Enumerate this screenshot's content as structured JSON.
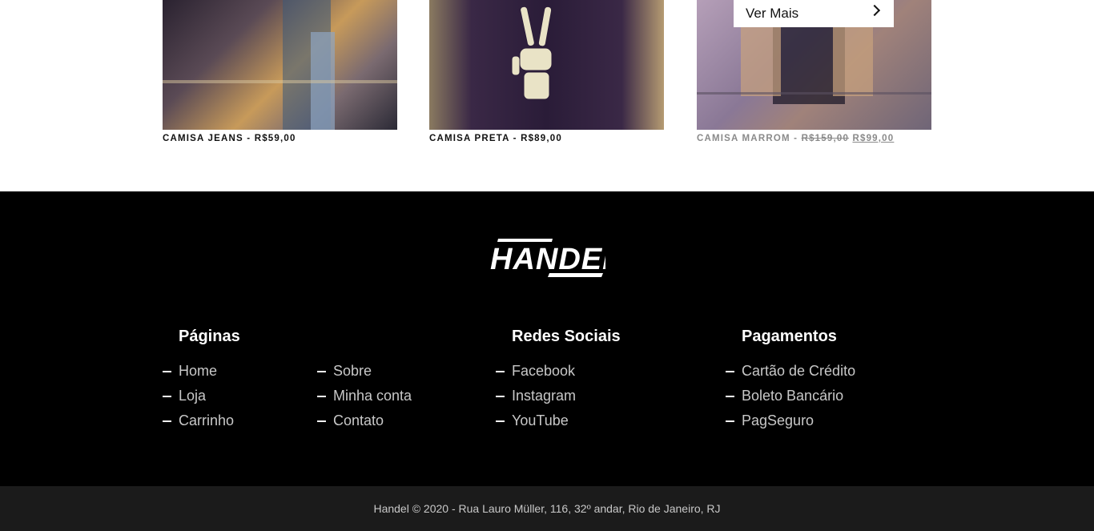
{
  "products": [
    {
      "name": "CAMISA JEANS",
      "separator": " - ",
      "price": "R$59,00",
      "image": "denim-jacket-photo"
    },
    {
      "name": "CAMISA PRETA",
      "separator": " - ",
      "price": "R$89,00",
      "image": "skeleton-hand-tshirt-photo"
    },
    {
      "name": "CAMISA MARROM",
      "separator": " - ",
      "old_price": "R$159,00",
      "new_price": "R$99,00",
      "overlay_button": "Ver Mais",
      "image": "brown-jacket-photo"
    }
  ],
  "footer": {
    "logo": "HANDEL",
    "columns": {
      "paginas": {
        "title": "Páginas",
        "links_left": [
          "Home",
          "Loja",
          "Carrinho"
        ],
        "links_right": [
          "Sobre",
          "Minha conta",
          "Contato"
        ]
      },
      "redes": {
        "title": "Redes Sociais",
        "links": [
          "Facebook",
          "Instagram",
          "YouTube"
        ]
      },
      "pagamentos": {
        "title": "Pagamentos",
        "links": [
          "Cartão de Crédito",
          "Boleto Bancário",
          "PagSeguro"
        ]
      }
    },
    "copyright": "Handel © 2020 - Rua Lauro Müller, 116, 32º andar, Rio de Janeiro, RJ"
  },
  "colors": {
    "footer_bg": "#000000",
    "bottom_bar_bg": "#1b1b1b",
    "link": "#c8c8c8",
    "muted_caption": "#8a8a8a"
  }
}
